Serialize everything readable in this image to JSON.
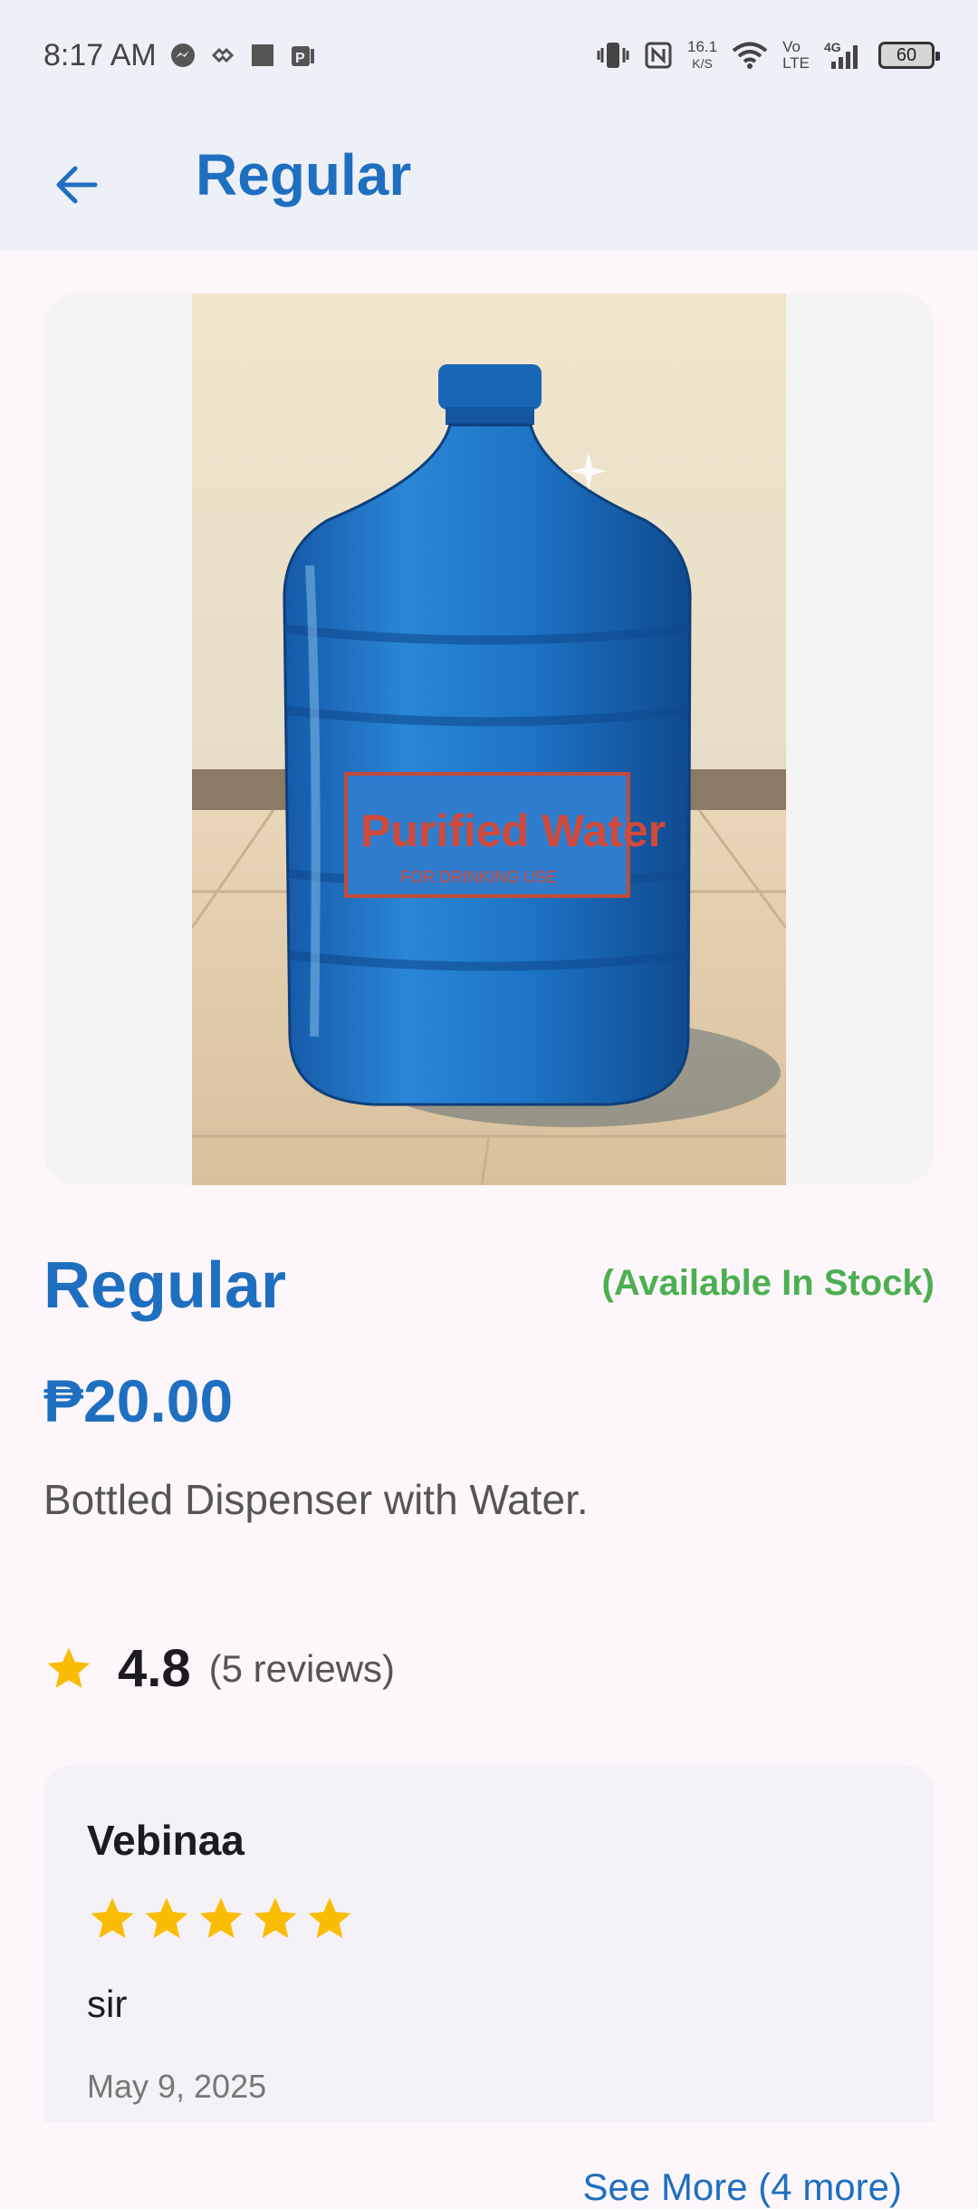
{
  "status_bar": {
    "time": "8:17 AM",
    "speed_value": "16.1",
    "speed_unit": "K/S",
    "volte_top": "Vo",
    "volte_bottom": "LTE",
    "network": "4G",
    "battery": "60"
  },
  "app_bar": {
    "title": "Regular"
  },
  "product": {
    "image_label_main": "Purified Water",
    "image_label_sub": "FOR DRINKING USE",
    "name": "Regular",
    "stock_status": "(Available In Stock)",
    "price": "₱20.00",
    "description": "Bottled Dispenser with Water."
  },
  "rating": {
    "value": "4.8",
    "reviews_label": "(5 reviews)"
  },
  "review": {
    "name": "Vebinaa",
    "stars": 5,
    "text": "sir",
    "date": "May 9, 2025"
  },
  "see_more_label": "See More (4 more)",
  "colors": {
    "primary": "#1f6fc0",
    "stock_green": "#4caf50",
    "star": "#fbbc04"
  }
}
